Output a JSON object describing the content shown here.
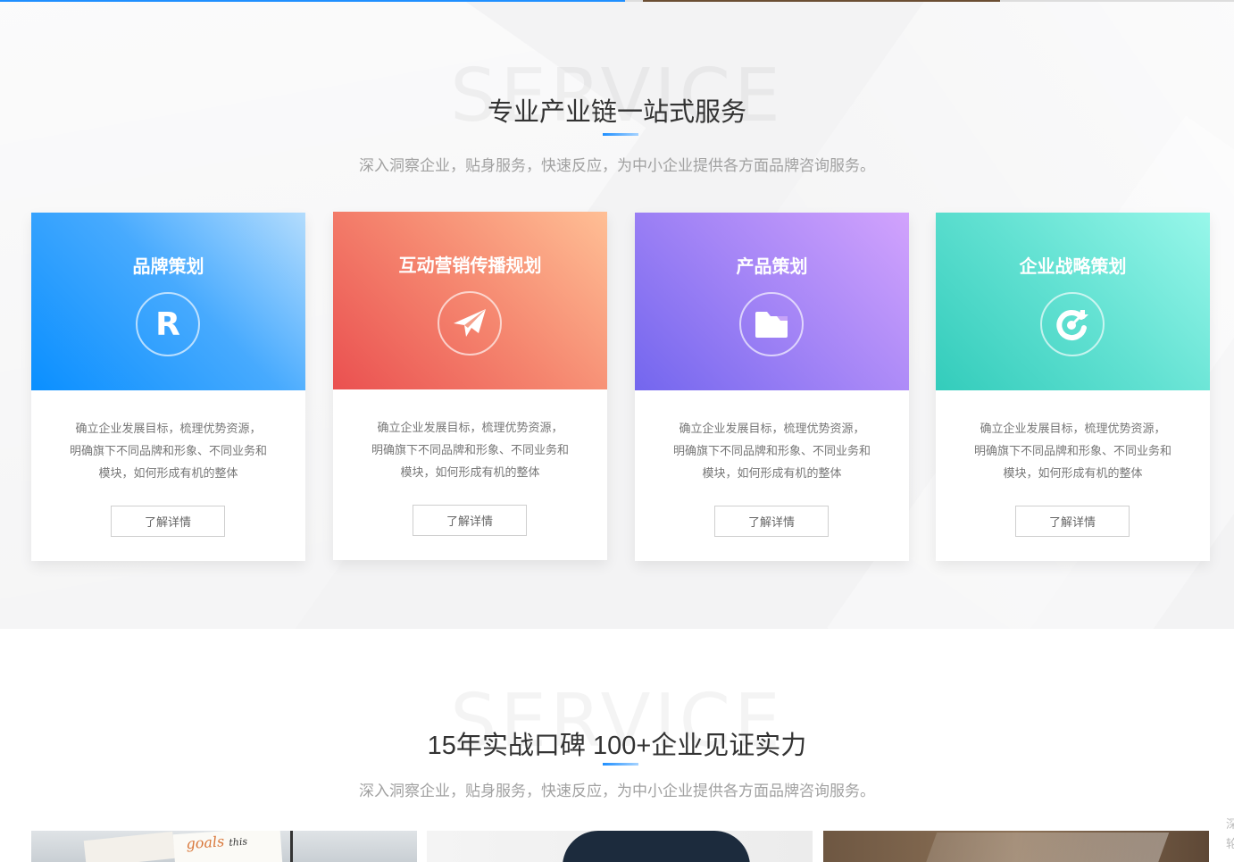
{
  "section_service": {
    "bg_word": "SERVICE",
    "title": "专业产业链一站式服务",
    "subtitle": "深入洞察企业，贴身服务，快速反应，为中小企业提供各方面品牌咨询服务。"
  },
  "cards": [
    {
      "title": "品牌策划",
      "icon": "r-letter-icon",
      "icon_glyph": "R",
      "desc_lines": [
        "确立企业发展目标，梳理优势资源，",
        "明确旗下不同品牌和形象、不同业务和",
        "模块，如何形成有机的整体"
      ],
      "button": "了解详情",
      "colors": [
        "#0a8fff",
        "#b3dcfd"
      ]
    },
    {
      "title": "互动营销传播规划",
      "icon": "paper-plane-icon",
      "desc_lines": [
        "确立企业发展目标，梳理优势资源，",
        "明确旗下不同品牌和形象、不同业务和",
        "模块，如何形成有机的整体"
      ],
      "button": "了解详情",
      "colors": [
        "#ea5050",
        "#ffbf95"
      ]
    },
    {
      "title": "产品策划",
      "icon": "folder-icon",
      "desc_lines": [
        "确立企业发展目标，梳理优势资源，",
        "明确旗下不同品牌和形象、不同业务和",
        "模块，如何形成有机的整体"
      ],
      "button": "了解详情",
      "colors": [
        "#7366ee",
        "#d2a3fd"
      ]
    },
    {
      "title": "企业战略策划",
      "icon": "target-icon",
      "desc_lines": [
        "确立企业发展目标，梳理优势资源，",
        "明确旗下不同品牌和形象、不同业务和",
        "模块，如何形成有机的整体"
      ],
      "button": "了解详情",
      "colors": [
        "#33ccbb",
        "#98f7ea"
      ]
    }
  ],
  "section_reputation": {
    "bg_word": "SERVICE",
    "title": "15年实战口碑 100+企业见证实力",
    "subtitle": "深入洞察企业，贴身服务，快速反应，为中小企业提供各方面品牌咨询服务。",
    "photo1_text": "goals",
    "photo1_text2": "this"
  },
  "side_text": "深 轮"
}
